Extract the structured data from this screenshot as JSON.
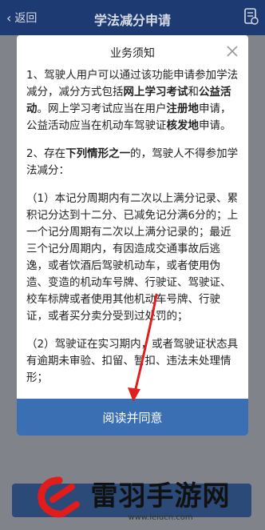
{
  "topbar": {
    "back_label": "返回",
    "title": "学法减分申请"
  },
  "modal": {
    "title": "业务须知",
    "para1": {
      "t1": "1、驾驶人用户可以通过该功能申请参加学法减分，减分方式包括",
      "b1": "网上学习考试",
      "t2": "和",
      "b2": "公益活动",
      "t3": "。网上学习考试应当在用户",
      "b3": "注册地",
      "t4": "申请，公益活动应当在机动车驾驶证",
      "b4": "核发地",
      "t5": "申请。"
    },
    "para2": {
      "t1": "2、存在",
      "b1": "下列情形之一",
      "t2": "的，驾驶人不得参加学法减分："
    },
    "para3": "（1）本记分周期内有二次以上满分记录、累积记分达到十二分、已减免记分满6分的；上一个记分周期有二次以上满分记录的；最近三个记分周期内，有因造成交通事故后逃逸，或者饮酒后驾驶机动车，或者使用伪造、变造的机动车号牌、行驶证、驾驶证、校车标牌或者使用其他机动车号牌、行驶证，或者买分卖分受到过处罚的；",
    "para4": "（2）驾驶证在实习期内，或者驾驶证状态具有逾期未审验、扣留、暂扣、违法未处理情形；",
    "agree_label": "阅读并同意"
  },
  "watermark": {
    "name": "雷羽手游网",
    "url": "www.leiucn.com"
  },
  "colors": {
    "topbar": "#1e3a73",
    "agree_button": "#3a6fb4",
    "arrow": "#e0201c",
    "watermark_red": "#e21b1b"
  }
}
